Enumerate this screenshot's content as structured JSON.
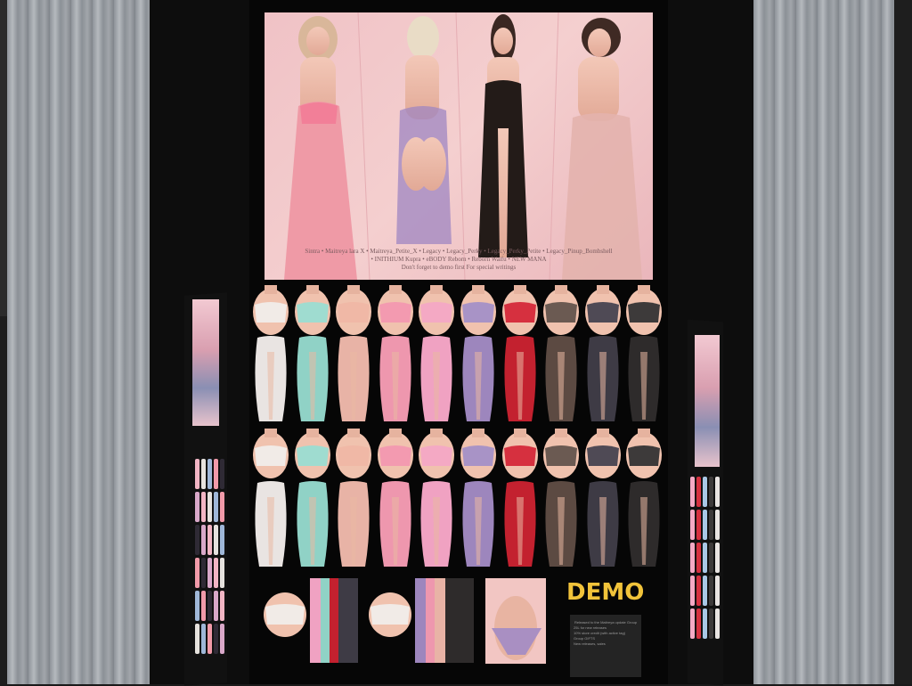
{
  "scene": {
    "poster": {
      "credits_line1": "Sintra • Maitreya lara X • Maitreya_Petite_X • Legacy • Legacy_Perky • Legacy_Perky_Petite • Legacy_Pinup_Bombshell",
      "credits_line2": "• INITHIUM Kupra • eBODY Reborn • Reborn Waifu • NEW MANA",
      "credits_line3": "Don't forget to demo first          For special writings"
    },
    "demo_label": "DEMO",
    "info_panel": {
      "heading": "Released to the Maitreya update Group",
      "lines": [
        "25L for new releases",
        "10% store credit (with active tag)",
        "Group GIFTS",
        "New releases, sales"
      ]
    }
  },
  "product_colors": {
    "tops": [
      "#f1ebe7",
      "#9fdcd0",
      "#f0b8a6",
      "#f39ab0",
      "#f4a9c4",
      "#a893c6",
      "#d6303f",
      "#6b5a52",
      "#4f4a55",
      "#3d3a3a"
    ],
    "skirts": [
      "#e9e4e2",
      "#90d2c6",
      "#e8b3a6",
      "#ee97ae",
      "#f0a2c2",
      "#9d86bd",
      "#c3212f",
      "#5c4a42",
      "#3e3b45",
      "#2e2b2b"
    ]
  },
  "icons": [
    "poster-image",
    "side-vendor-poster",
    "product-swatch"
  ]
}
